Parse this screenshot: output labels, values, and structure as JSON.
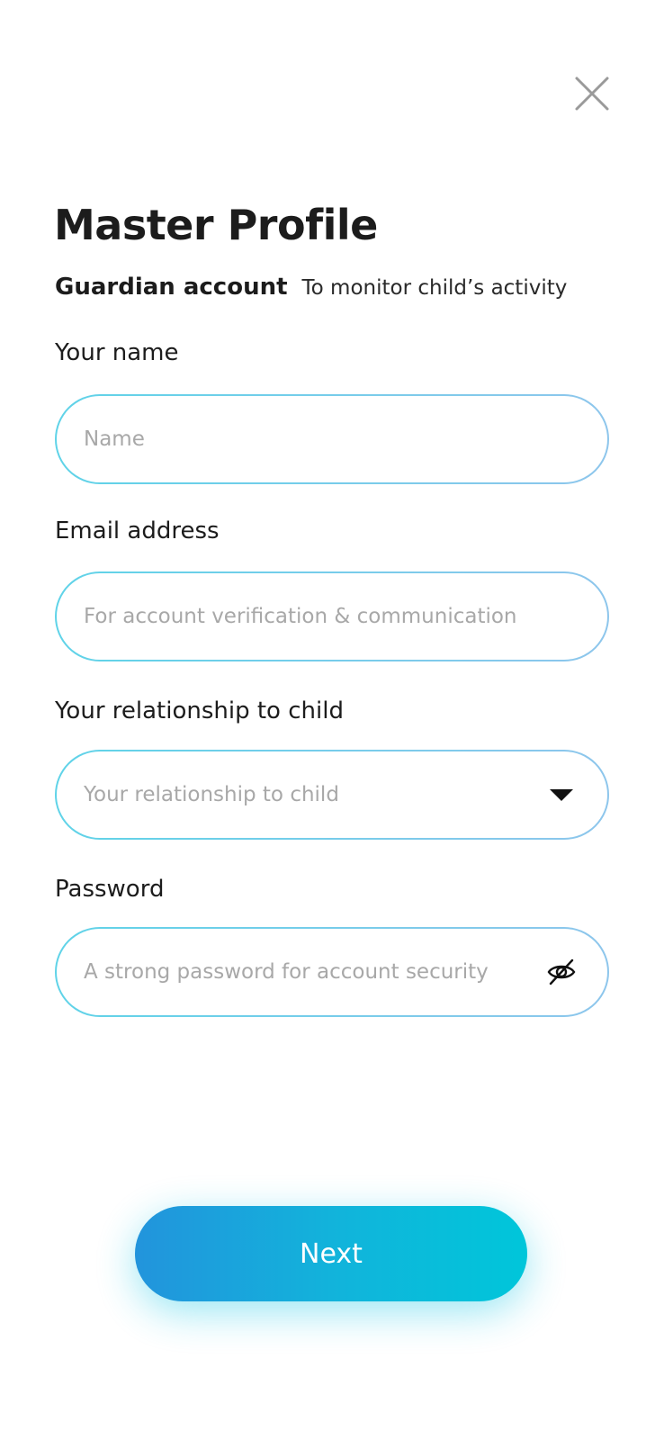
{
  "header": {
    "close_icon": "close-icon",
    "title": "Master Profile",
    "subtitle_strong": "Guardian account",
    "subtitle_note": "To monitor child’s activity"
  },
  "form": {
    "name": {
      "label": "Your name",
      "placeholder": "Name",
      "value": ""
    },
    "email": {
      "label": "Email address",
      "placeholder": "For account verification & communication",
      "value": ""
    },
    "relationship": {
      "label": "Your relationship to child",
      "placeholder": "Your relationship to child",
      "icon": "chevron-down-icon"
    },
    "password": {
      "label": "Password",
      "placeholder": "A strong password for account security",
      "value": "",
      "icon": "eye-off-icon"
    }
  },
  "actions": {
    "next_label": "Next"
  },
  "colors": {
    "field_border_start": "#5fd3e8",
    "field_border_end": "#8ec6ec",
    "button_gradient_start": "#2294dc",
    "button_gradient_end": "#00c6da",
    "placeholder": "#a8a8a8"
  }
}
